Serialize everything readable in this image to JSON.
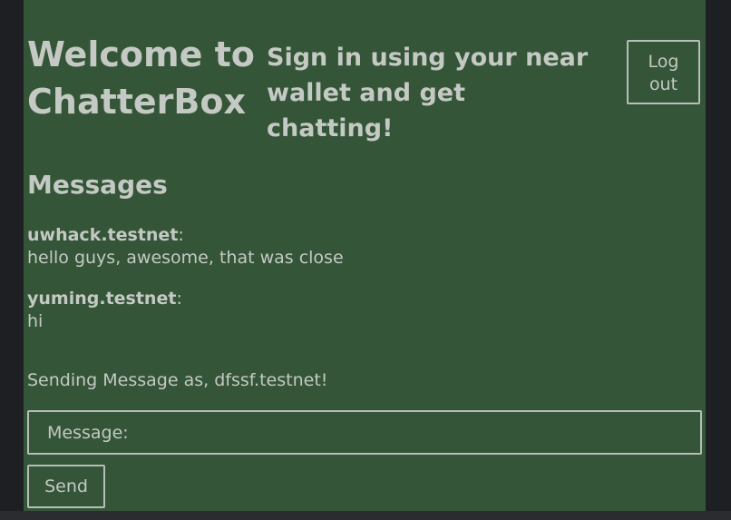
{
  "header": {
    "title": "Welcome to ChatterBox",
    "subtitle": "Sign in using your near wallet and get chatting!",
    "logout_label": "Log out"
  },
  "messages_section": {
    "title": "Messages",
    "messages": [
      {
        "sender": "uwhack.testnet",
        "separator": ":",
        "text": "hello guys, awesome, that was close"
      },
      {
        "sender": "yuming.testnet",
        "separator": ":",
        "text": "hi"
      }
    ]
  },
  "composer": {
    "sending_as": "Sending Message as, dfssf.testnet!",
    "message_placeholder": "Message:",
    "message_value": "",
    "send_label": "Send"
  },
  "colors": {
    "panel_background": "#345537",
    "page_background": "#1e1f22",
    "text": "#c4c9c4",
    "border": "#b7bdb7"
  }
}
